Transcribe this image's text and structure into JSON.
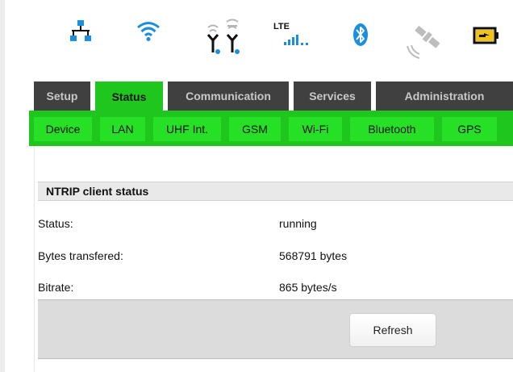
{
  "status_icons": [
    {
      "name": "ethernet-icon"
    },
    {
      "name": "wifi-icon"
    },
    {
      "name": "uhf-antennas-icon"
    },
    {
      "name": "lte-signal-icon",
      "label": "LTE"
    },
    {
      "name": "bluetooth-icon"
    },
    {
      "name": "satellite-icon"
    },
    {
      "name": "battery-charging-icon"
    }
  ],
  "main_tabs": [
    {
      "label": "Setup",
      "active": false
    },
    {
      "label": "Status",
      "active": true
    },
    {
      "label": "Communication",
      "active": false
    },
    {
      "label": "Services",
      "active": false
    },
    {
      "label": "Administration",
      "active": false
    }
  ],
  "sub_tabs": [
    {
      "label": "Device"
    },
    {
      "label": "LAN"
    },
    {
      "label": "UHF Int."
    },
    {
      "label": "GSM"
    },
    {
      "label": "Wi-Fi"
    },
    {
      "label": "Bluetooth"
    },
    {
      "label": "GPS"
    }
  ],
  "section": {
    "title": "NTRIP client status",
    "rows": [
      {
        "label": "Status:",
        "value": "running"
      },
      {
        "label": "Bytes transfered:",
        "value": "568791 bytes"
      },
      {
        "label": "Bitrate:",
        "value": "865 bytes/s"
      }
    ]
  },
  "refresh_label": "Refresh",
  "colors": {
    "accent_green": "#1ec61e",
    "tab_dark": "#404040",
    "icon_blue": "#1a8fe0"
  }
}
